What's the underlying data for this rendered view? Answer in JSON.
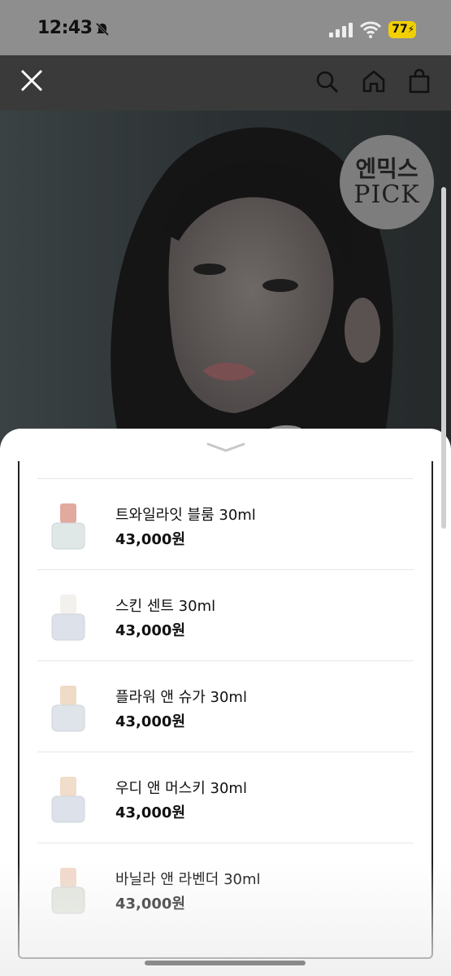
{
  "status_bar": {
    "time": "12:43",
    "battery": "77"
  },
  "nav": {
    "close_icon": "close-icon",
    "search_icon": "search-icon",
    "home_icon": "home-icon",
    "cart_icon": "shopping-bag-icon"
  },
  "hero": {
    "badge_line1": "엔믹스",
    "badge_line2": "PICK"
  },
  "products": [
    {
      "name": "트와일라잇 블룸 30ml",
      "price": "43,000원",
      "cap_color": "#e2a99f",
      "bottle_color": "#dfe7e7"
    },
    {
      "name": "스킨 센트 30ml",
      "price": "43,000원",
      "cap_color": "#f3f1ee",
      "bottle_color": "#dde2ea"
    },
    {
      "name": "플라워 앤 슈가 30ml",
      "price": "43,000원",
      "cap_color": "#efdcc6",
      "bottle_color": "#dfe3ea"
    },
    {
      "name": "우디 앤 머스키 30ml",
      "price": "43,000원",
      "cap_color": "#f0ddca",
      "bottle_color": "#dde1ea"
    },
    {
      "name": "바닐라 앤 라벤더 30ml",
      "price": "43,000원",
      "cap_color": "#f1d8c9",
      "bottle_color": "#e1e4dc"
    }
  ]
}
